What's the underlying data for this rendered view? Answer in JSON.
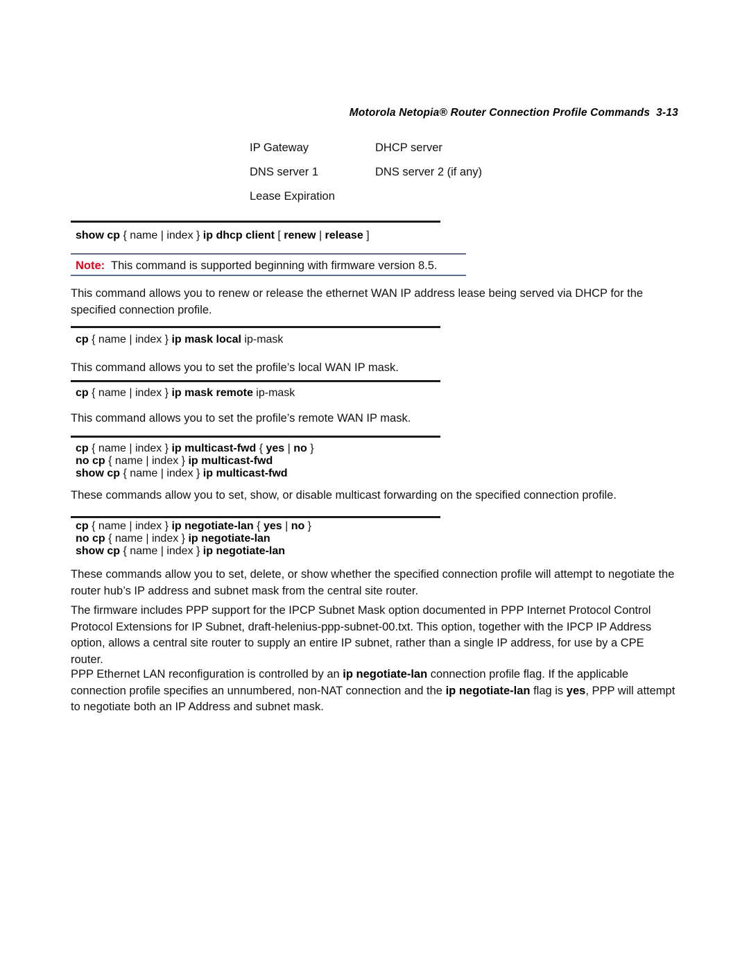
{
  "header": {
    "title": "Motorola Netopia® Router Connection Profile Commands",
    "page_number": "3-13"
  },
  "field_list": {
    "rows": [
      {
        "left": "IP Gateway",
        "right": "DHCP server"
      },
      {
        "left": "DNS server 1",
        "right": "DNS server 2 (if any)"
      },
      {
        "left": "Lease Expiration",
        "right": ""
      }
    ]
  },
  "blocks": {
    "dhcp_client": {
      "syntax_line_1": {
        "p1": "show cp ",
        "p2": "{ name | index } ",
        "p3": "ip dhcp client ",
        "p4": "[ ",
        "p5": "renew",
        "p6": " | ",
        "p7": "release",
        "p8": " ]"
      },
      "note": {
        "label": "Note:",
        "text": "  This command is supported beginning with firmware version 8.5."
      },
      "description": "This command allows you to renew or release the ethernet WAN IP address lease being served via DHCP for the specified connection profile."
    },
    "ip_mask_local": {
      "syntax": {
        "p1": "cp ",
        "p2": "{ name | index } ",
        "p3": "ip mask local ",
        "p4": "ip-mask"
      },
      "description": "This command allows you to set the profile’s local WAN IP mask."
    },
    "ip_mask_remote": {
      "syntax": {
        "p1": "cp ",
        "p2": "{ name | index } ",
        "p3": "ip mask remote ",
        "p4": "ip-mask"
      },
      "description": "This command allows you to set the profile’s remote WAN IP mask."
    },
    "ip_multicast_fwd": {
      "syntax_1": {
        "p1": "cp ",
        "p2": "{ name | index } ",
        "p3": "ip multicast-fwd ",
        "p4": "{ ",
        "p5": "yes",
        "p6": " | ",
        "p7": "no",
        "p8": " }"
      },
      "syntax_2": {
        "p1": "no cp ",
        "p2": "{ name | index } ",
        "p3": "ip multicast-fwd"
      },
      "syntax_3": {
        "p1": "show cp ",
        "p2": "{ name | index } ",
        "p3": "ip multicast-fwd"
      },
      "description": "These commands allow you to set, show, or disable multicast forwarding on the specified connection profile."
    },
    "ip_negotiate_lan": {
      "syntax_1": {
        "p1": "cp ",
        "p2": "{ name | index } ",
        "p3": "ip negotiate-lan ",
        "p4": "{ ",
        "p5": "yes",
        "p6": " | ",
        "p7": "no",
        "p8": " }"
      },
      "syntax_2": {
        "p1": "no cp ",
        "p2": "{ name | index } ",
        "p3": "ip negotiate-lan"
      },
      "syntax_3": {
        "p1": "show cp ",
        "p2": "{ name | index } ",
        "p3": "ip negotiate-lan"
      },
      "description": "These commands allow you to set, delete, or show whether the specified connection profile will attempt to negotiate the router hub’s IP address and subnet mask from the central site router."
    }
  },
  "paragraphs": {
    "ipcp": {
      "part1": "The firmware includes PPP support for the IPCP Subnet Mask option documented in PPP Internet Protocol Control Protocol Extensions for IP Subnet,",
      "part2": " draft-helenius-ppp-subnet-00.txt",
      "part3": ". This option, together with the IPCP IP Address option, allows a central site router to supply an entire IP subnet, rather than a single IP address, for use by a CPE router."
    },
    "ppp_lan": {
      "s1": "PPP Ethernet LAN reconfiguration is controlled by an ",
      "s2": "ip negotiate-lan",
      "s3": " connection profile flag. If the applicable connection profile specifies an unnumbered, non-NAT connection and the ",
      "s4": "ip negotiate-lan",
      "s5": " flag is ",
      "s6": "yes",
      "s7": ", PPP will attempt to negotiate both an IP Address and subnet mask."
    }
  }
}
